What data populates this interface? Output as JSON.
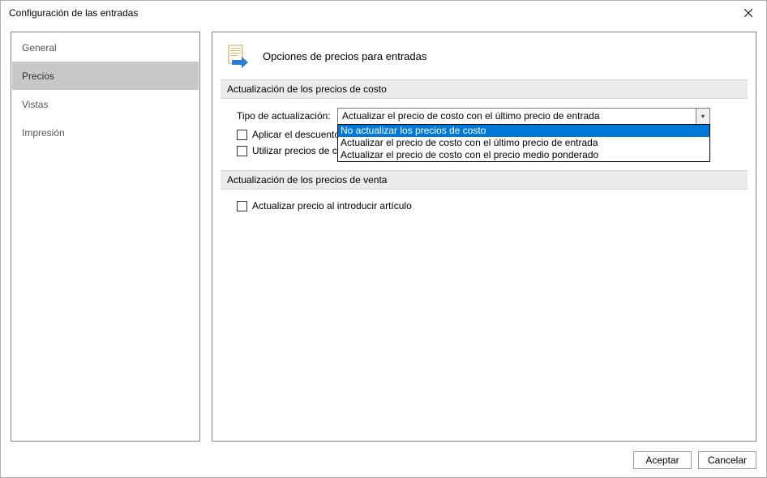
{
  "window": {
    "title": "Configuración de las entradas"
  },
  "sidebar": {
    "items": [
      {
        "label": "General"
      },
      {
        "label": "Precios"
      },
      {
        "label": "Vistas"
      },
      {
        "label": "Impresión"
      }
    ]
  },
  "page": {
    "title": "Opciones de precios para entradas"
  },
  "section_cost": {
    "header": "Actualización de los precios de costo",
    "update_type_label": "Tipo de actualización:",
    "selected_value": "Actualizar el precio de costo con el último precio de entrada",
    "options": [
      "No actualizar los precios de costo",
      "Actualizar el precio de costo con el último precio de entrada",
      "Actualizar el precio de costo con el precio medio ponderado"
    ],
    "checkbox_discount": "Aplicar el descuento",
    "checkbox_use_prices": "Utilizar precios de co"
  },
  "section_sale": {
    "header": "Actualización de los precios de venta",
    "checkbox_update": "Actualizar precio al introducir artículo"
  },
  "buttons": {
    "ok": "Aceptar",
    "cancel": "Cancelar"
  }
}
